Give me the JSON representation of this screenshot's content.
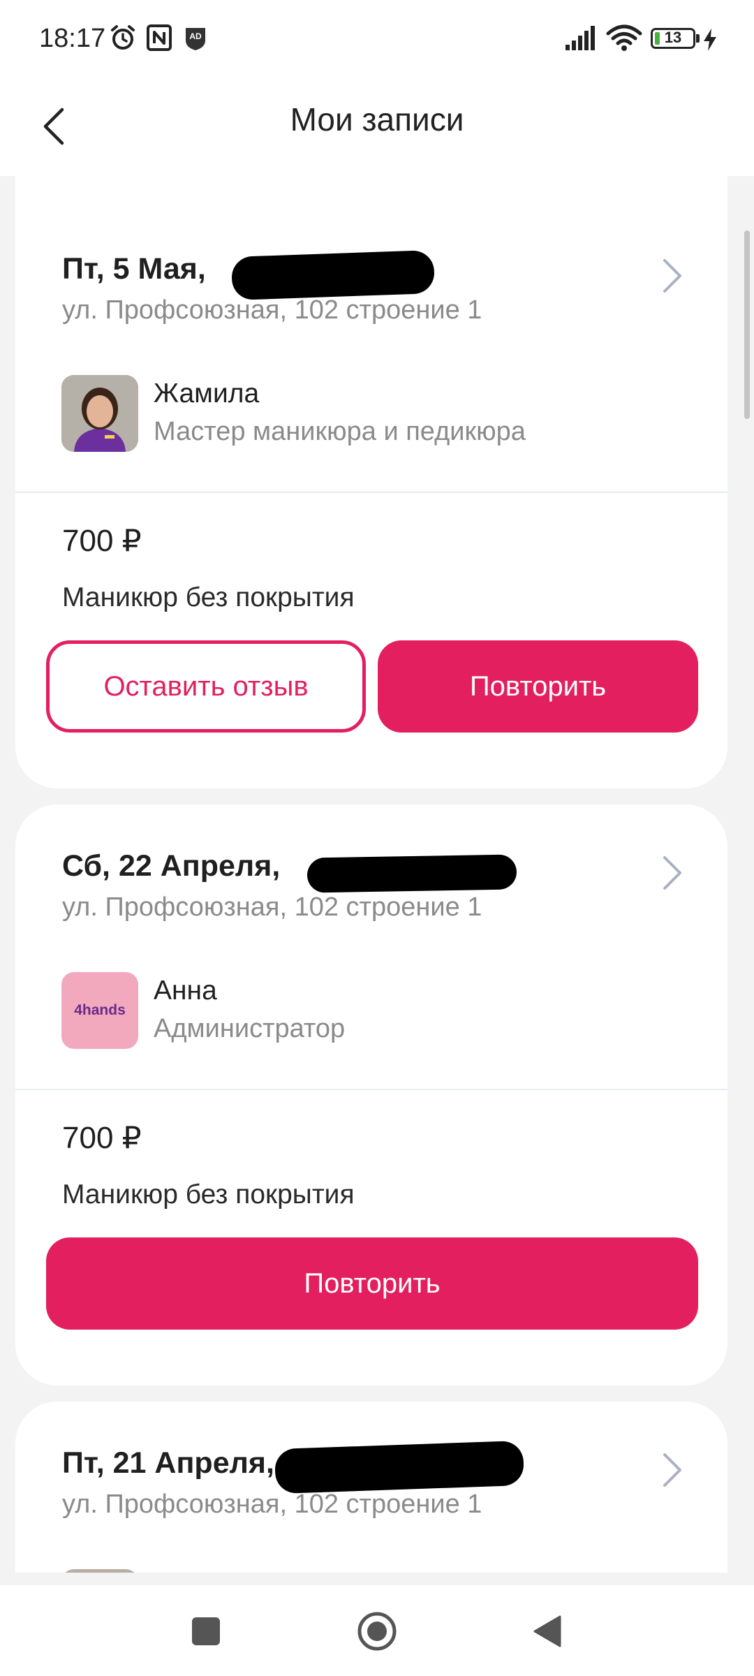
{
  "status_bar": {
    "time": "18:17",
    "battery_level": "13",
    "battery_percent": 13,
    "icons": [
      "alarm-icon",
      "nfc-icon",
      "adblocker-icon",
      "signal-icon",
      "wifi-icon",
      "battery-icon",
      "charging-icon"
    ]
  },
  "header": {
    "title": "Мои записи",
    "back_icon": "back-arrow-icon"
  },
  "colors": {
    "accent": "#e31f5f",
    "background": "#f3f3f3",
    "card": "#ffffff",
    "secondary_text": "#8a8a8a"
  },
  "appointments": [
    {
      "date": "Пт, 5 Мая,",
      "address": "ул. Профсоюзная, 102 строение 1",
      "master_name": "Жамила",
      "master_role": "Мастер маникюра и педикюра",
      "price": "700 ₽",
      "service": "Маникюр без покрытия",
      "review_label": "Оставить отзыв",
      "repeat_label": "Повторить"
    },
    {
      "date": "Сб, 22 Апреля,",
      "address": "ул. Профсоюзная, 102 строение 1",
      "master_name": "Анна",
      "master_role": "Администратор",
      "avatar_text": "4hands",
      "price": "700 ₽",
      "service": "Маникюр без покрытия",
      "repeat_label": "Повторить"
    },
    {
      "date": "Пт, 21 Апреля,",
      "address": "ул. Профсоюзная, 102 строение 1"
    }
  ],
  "nav_bar": {
    "icons": [
      "recents-square-icon",
      "home-circle-icon",
      "back-triangle-icon"
    ]
  }
}
